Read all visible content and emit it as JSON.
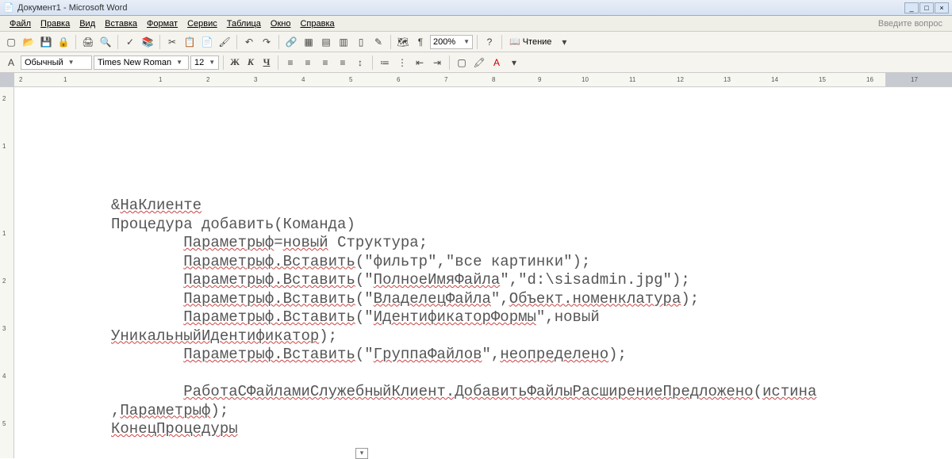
{
  "window": {
    "title": "Документ1 - Microsoft Word"
  },
  "menus": [
    "Файл",
    "Правка",
    "Вид",
    "Вставка",
    "Формат",
    "Сервис",
    "Таблица",
    "Окно",
    "Справка"
  ],
  "help_placeholder": "Введите вопрос",
  "zoom": "200%",
  "reading_label": "Чтение",
  "style": "Обычный",
  "font": "Times New Roman",
  "size": "12",
  "bold": "Ж",
  "italic": "К",
  "underline": "Ч",
  "ruler_numbers": [
    "2",
    "1",
    "1",
    "2",
    "3",
    "4",
    "5",
    "6",
    "7",
    "8",
    "9",
    "10",
    "11",
    "12",
    "13",
    "14",
    "15",
    "16",
    "17"
  ],
  "code": {
    "l1a": "&",
    "l1b": "НаКлиенте",
    "l2": "Процедура добавить(Команда)",
    "l3a": "        ",
    "l3b": "Параметрыф",
    "l3c": "=",
    "l3d": "новый",
    "l3e": " Структура;",
    "l4a": "        ",
    "l4b": "Параметрыф.Вставить",
    "l4c": "(\"фильтр\",\"все картинки\");",
    "l5a": "        ",
    "l5b": "Параметрыф.Вставить",
    "l5c": "(\"",
    "l5d": "ПолноеИмяФайла",
    "l5e": "\",\"d:\\sisadmin.jpg\");",
    "l6a": "        ",
    "l6b": "Параметрыф.Вставить",
    "l6c": "(\"",
    "l6d": "ВладелецФайла",
    "l6e": "\",",
    "l6f": "Объект.номенклатура",
    "l6g": ");",
    "l7a": "        ",
    "l7b": "Параметрыф.Вставить",
    "l7c": "(\"",
    "l7d": "ИдентификаторФормы",
    "l7e": "\",новый ",
    "l8a": "УникальныйИдентификатор",
    "l8b": ");",
    "l9a": "        ",
    "l9b": "Параметрыф.Вставить",
    "l9c": "(\"",
    "l9d": "ГруппаФайлов",
    "l9e": "\",",
    "l9f": "неопределено",
    "l9g": ");",
    "l10": "",
    "l11a": "        ",
    "l11b": "РаботаСФайламиСлужебныйКлиент.ДобавитьФайлыРасширениеПредложено",
    "l11c": "(",
    "l11d": "истина",
    "l12a": ",",
    "l12b": "Параметрыф",
    "l12c": ");",
    "l13": "КонецПроцедуры"
  }
}
